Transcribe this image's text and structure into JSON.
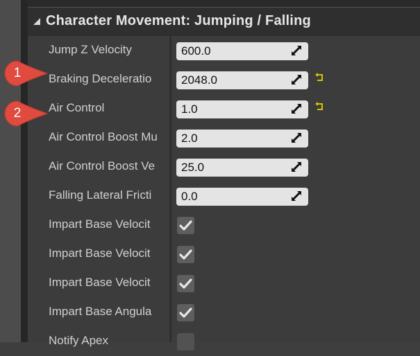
{
  "section": {
    "title": "Character Movement: Jumping / Falling"
  },
  "rows": [
    {
      "label": "Jump Z Velocity",
      "value": "600.0",
      "type": "number",
      "reset": false
    },
    {
      "label": "Braking Deceleratio",
      "value": "2048.0",
      "type": "number",
      "reset": true
    },
    {
      "label": "Air Control",
      "value": "1.0",
      "type": "number",
      "reset": true
    },
    {
      "label": "Air Control Boost Mu",
      "value": "2.0",
      "type": "number",
      "reset": false
    },
    {
      "label": "Air Control Boost Ve",
      "value": "25.0",
      "type": "number",
      "reset": false
    },
    {
      "label": "Falling Lateral Fricti",
      "value": "0.0",
      "type": "number",
      "reset": false
    },
    {
      "label": "Impart Base Velocit",
      "checked": true,
      "type": "checkbox"
    },
    {
      "label": "Impart Base Velocit",
      "checked": true,
      "type": "checkbox"
    },
    {
      "label": "Impart Base Velocit",
      "checked": true,
      "type": "checkbox"
    },
    {
      "label": "Impart Base Angula",
      "checked": true,
      "type": "checkbox"
    },
    {
      "label": "Notify Apex",
      "checked": false,
      "type": "checkbox"
    }
  ],
  "annotations": [
    {
      "number": "1"
    },
    {
      "number": "2"
    }
  ],
  "colors": {
    "badge": "#e04a3f",
    "reset_arrow": "#d4c400",
    "check": "#e8e8e8"
  }
}
